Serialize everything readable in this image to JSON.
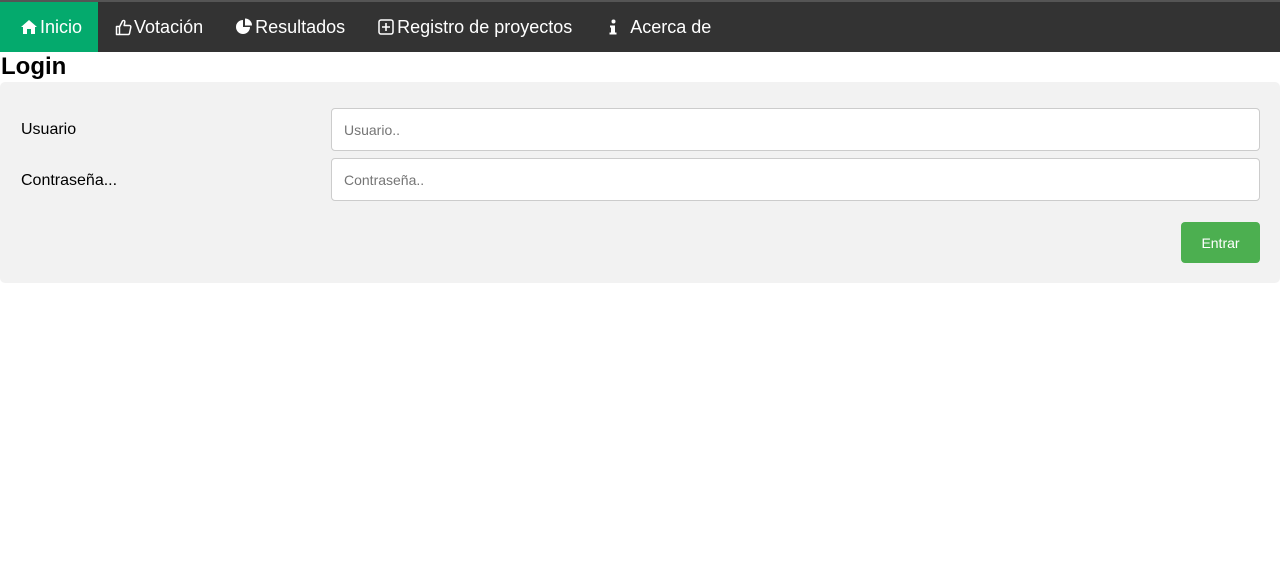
{
  "nav": {
    "items": [
      {
        "label": "Inicio",
        "icon": "home-icon",
        "active": true
      },
      {
        "label": "Votación",
        "icon": "thumbs-up-icon",
        "active": false
      },
      {
        "label": "Resultados",
        "icon": "pie-chart-icon",
        "active": false
      },
      {
        "label": "Registro de proyectos",
        "icon": "plus-square-icon",
        "active": false
      },
      {
        "label": "Acerca de",
        "icon": "info-icon",
        "active": false
      }
    ]
  },
  "page": {
    "title": "Login"
  },
  "form": {
    "username": {
      "label": "Usuario",
      "placeholder": "Usuario..",
      "value": ""
    },
    "password": {
      "label": "Contraseña...",
      "placeholder": "Contraseña..",
      "value": ""
    },
    "submit_label": "Entrar"
  },
  "colors": {
    "topbar_bg": "#333333",
    "active_nav_bg": "#04AA6D",
    "panel_bg": "#f2f2f2",
    "submit_bg": "#4CAF50"
  }
}
